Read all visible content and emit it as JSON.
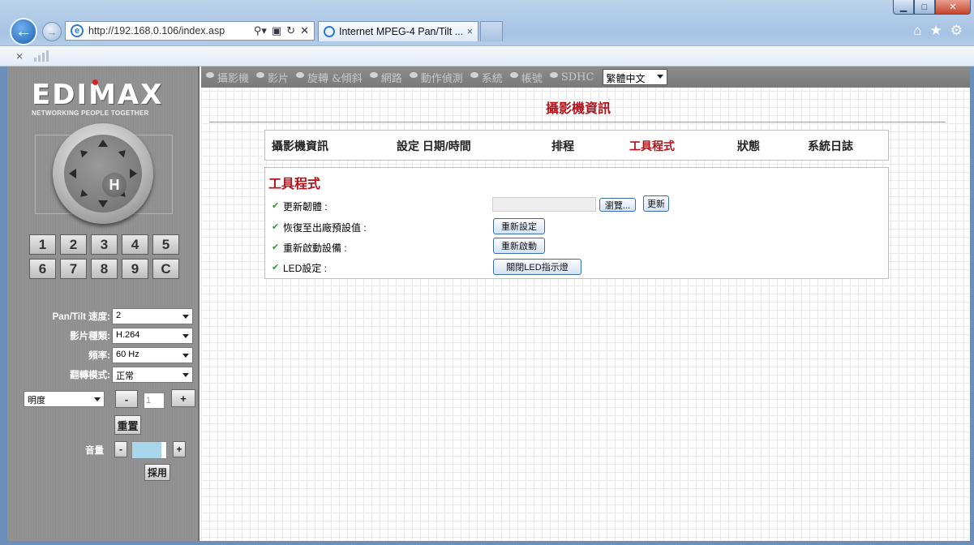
{
  "browser": {
    "url": "http://192.168.0.106/index.asp",
    "tab_title": "Internet MPEG-4 Pan/Tilt ...",
    "tab_close": "×",
    "cmd_close": "×"
  },
  "logo": {
    "brand": "EDIMAX",
    "tagline": "NETWORKING PEOPLE TOGETHER"
  },
  "ptz": {
    "home_label": "H"
  },
  "presets": [
    "1",
    "2",
    "3",
    "4",
    "5",
    "6",
    "7",
    "8",
    "9",
    "C"
  ],
  "controls": {
    "pantilt_speed": {
      "label": "Pan/Tilt 速度:",
      "value": "2"
    },
    "video_type": {
      "label": "影片種類:",
      "value": "H.264"
    },
    "frequency": {
      "label": "頻率:",
      "value": "60 Hz"
    },
    "flip_mode": {
      "label": "翻轉模式:",
      "value": "正常"
    },
    "image_adjust": {
      "value": "明度",
      "minus": "-",
      "level": "1",
      "plus": "+"
    },
    "reset_label": "重置",
    "volume": {
      "label": "音量",
      "minus": "-",
      "plus": "+"
    },
    "apply_label": "採用"
  },
  "topnav": {
    "items": [
      "攝影機",
      "影片",
      "旋轉 &傾斜",
      "網路",
      "動作偵測",
      "系統",
      "帳號",
      "SDHC"
    ],
    "language": "繁體中文"
  },
  "page_title": "攝影機資訊",
  "subnav": {
    "items": [
      "攝影機資訊",
      "設定 日期/時間",
      "排程",
      "工具程式",
      "狀態",
      "系統日誌"
    ],
    "active_index": 3
  },
  "panel": {
    "title": "工具程式",
    "rows": [
      {
        "label": "更新韌體 :",
        "browse_label": "瀏覽...",
        "button_label": "更新"
      },
      {
        "label": "恢復至出廠預設值 :",
        "button_label": "重新設定"
      },
      {
        "label": "重新啟動設備 :",
        "button_label": "重新啟動"
      },
      {
        "label": "LED設定 :",
        "button_label": "關閉LED指示燈"
      }
    ]
  }
}
